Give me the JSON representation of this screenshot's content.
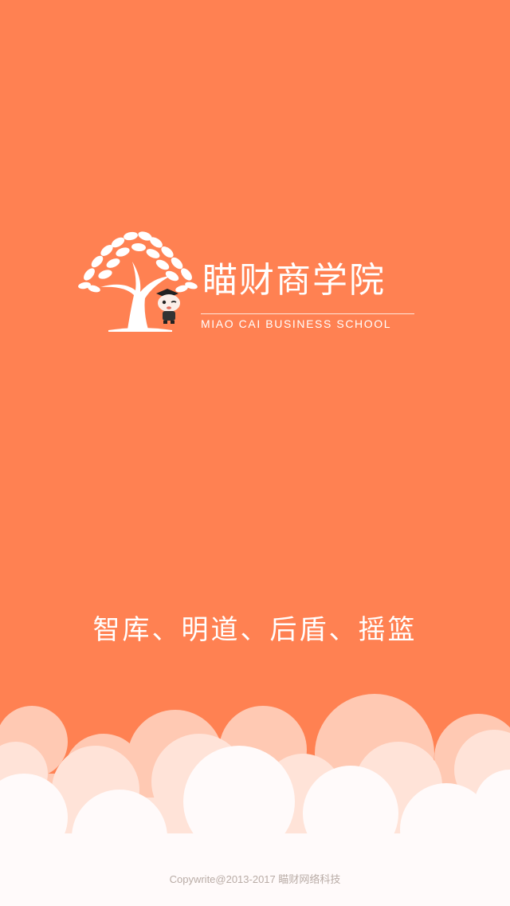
{
  "brand": {
    "name_cn": "瞄财商学院",
    "name_en": "MIAO CAI BUSINESS SCHOOL",
    "logo_icon": "tree-icon",
    "mascot_icon": "mascot-icon"
  },
  "slogan": "智库、明道、后盾、摇篮",
  "footer": {
    "copyright": "Copywrite@2013-2017 瞄财网络科技"
  },
  "colors": {
    "background": "#ff8152",
    "cloud_back": "#ffc9b3",
    "cloud_mid": "#ffe3d8",
    "cloud_front": "#fffafa",
    "text": "#ffffff",
    "footer_text": "#b9aca6"
  }
}
